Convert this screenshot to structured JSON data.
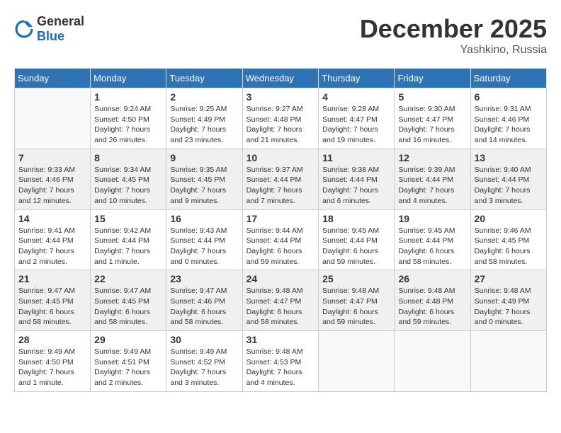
{
  "header": {
    "logo": {
      "general": "General",
      "blue": "Blue"
    },
    "title": "December 2025",
    "location": "Yashkino, Russia"
  },
  "calendar": {
    "columns": [
      "Sunday",
      "Monday",
      "Tuesday",
      "Wednesday",
      "Thursday",
      "Friday",
      "Saturday"
    ],
    "weeks": [
      {
        "days": [
          null,
          {
            "date": "1",
            "sunrise": "9:24 AM",
            "sunset": "4:50 PM",
            "daylight": "7 hours and 26 minutes."
          },
          {
            "date": "2",
            "sunrise": "9:25 AM",
            "sunset": "4:49 PM",
            "daylight": "7 hours and 23 minutes."
          },
          {
            "date": "3",
            "sunrise": "9:27 AM",
            "sunset": "4:48 PM",
            "daylight": "7 hours and 21 minutes."
          },
          {
            "date": "4",
            "sunrise": "9:28 AM",
            "sunset": "4:47 PM",
            "daylight": "7 hours and 19 minutes."
          },
          {
            "date": "5",
            "sunrise": "9:30 AM",
            "sunset": "4:47 PM",
            "daylight": "7 hours and 16 minutes."
          },
          {
            "date": "6",
            "sunrise": "9:31 AM",
            "sunset": "4:46 PM",
            "daylight": "7 hours and 14 minutes."
          }
        ]
      },
      {
        "days": [
          {
            "date": "7",
            "sunrise": "9:33 AM",
            "sunset": "4:46 PM",
            "daylight": "7 hours and 12 minutes."
          },
          {
            "date": "8",
            "sunrise": "9:34 AM",
            "sunset": "4:45 PM",
            "daylight": "7 hours and 10 minutes."
          },
          {
            "date": "9",
            "sunrise": "9:35 AM",
            "sunset": "4:45 PM",
            "daylight": "7 hours and 9 minutes."
          },
          {
            "date": "10",
            "sunrise": "9:37 AM",
            "sunset": "4:44 PM",
            "daylight": "7 hours and 7 minutes."
          },
          {
            "date": "11",
            "sunrise": "9:38 AM",
            "sunset": "4:44 PM",
            "daylight": "7 hours and 6 minutes."
          },
          {
            "date": "12",
            "sunrise": "9:39 AM",
            "sunset": "4:44 PM",
            "daylight": "7 hours and 4 minutes."
          },
          {
            "date": "13",
            "sunrise": "9:40 AM",
            "sunset": "4:44 PM",
            "daylight": "7 hours and 3 minutes."
          }
        ]
      },
      {
        "days": [
          {
            "date": "14",
            "sunrise": "9:41 AM",
            "sunset": "4:44 PM",
            "daylight": "7 hours and 2 minutes."
          },
          {
            "date": "15",
            "sunrise": "9:42 AM",
            "sunset": "4:44 PM",
            "daylight": "7 hours and 1 minute."
          },
          {
            "date": "16",
            "sunrise": "9:43 AM",
            "sunset": "4:44 PM",
            "daylight": "7 hours and 0 minutes."
          },
          {
            "date": "17",
            "sunrise": "9:44 AM",
            "sunset": "4:44 PM",
            "daylight": "6 hours and 59 minutes."
          },
          {
            "date": "18",
            "sunrise": "9:45 AM",
            "sunset": "4:44 PM",
            "daylight": "6 hours and 59 minutes."
          },
          {
            "date": "19",
            "sunrise": "9:45 AM",
            "sunset": "4:44 PM",
            "daylight": "6 hours and 58 minutes."
          },
          {
            "date": "20",
            "sunrise": "9:46 AM",
            "sunset": "4:45 PM",
            "daylight": "6 hours and 58 minutes."
          }
        ]
      },
      {
        "days": [
          {
            "date": "21",
            "sunrise": "9:47 AM",
            "sunset": "4:45 PM",
            "daylight": "6 hours and 58 minutes."
          },
          {
            "date": "22",
            "sunrise": "9:47 AM",
            "sunset": "4:45 PM",
            "daylight": "6 hours and 58 minutes."
          },
          {
            "date": "23",
            "sunrise": "9:47 AM",
            "sunset": "4:46 PM",
            "daylight": "6 hours and 58 minutes."
          },
          {
            "date": "24",
            "sunrise": "9:48 AM",
            "sunset": "4:47 PM",
            "daylight": "6 hours and 58 minutes."
          },
          {
            "date": "25",
            "sunrise": "9:48 AM",
            "sunset": "4:47 PM",
            "daylight": "6 hours and 59 minutes."
          },
          {
            "date": "26",
            "sunrise": "9:48 AM",
            "sunset": "4:48 PM",
            "daylight": "6 hours and 59 minutes."
          },
          {
            "date": "27",
            "sunrise": "9:48 AM",
            "sunset": "4:49 PM",
            "daylight": "7 hours and 0 minutes."
          }
        ]
      },
      {
        "days": [
          {
            "date": "28",
            "sunrise": "9:49 AM",
            "sunset": "4:50 PM",
            "daylight": "7 hours and 1 minute."
          },
          {
            "date": "29",
            "sunrise": "9:49 AM",
            "sunset": "4:51 PM",
            "daylight": "7 hours and 2 minutes."
          },
          {
            "date": "30",
            "sunrise": "9:49 AM",
            "sunset": "4:52 PM",
            "daylight": "7 hours and 3 minutes."
          },
          {
            "date": "31",
            "sunrise": "9:48 AM",
            "sunset": "4:53 PM",
            "daylight": "7 hours and 4 minutes."
          },
          null,
          null,
          null
        ]
      }
    ],
    "labels": {
      "sunrise": "Sunrise:",
      "sunset": "Sunset:",
      "daylight": "Daylight:"
    }
  }
}
